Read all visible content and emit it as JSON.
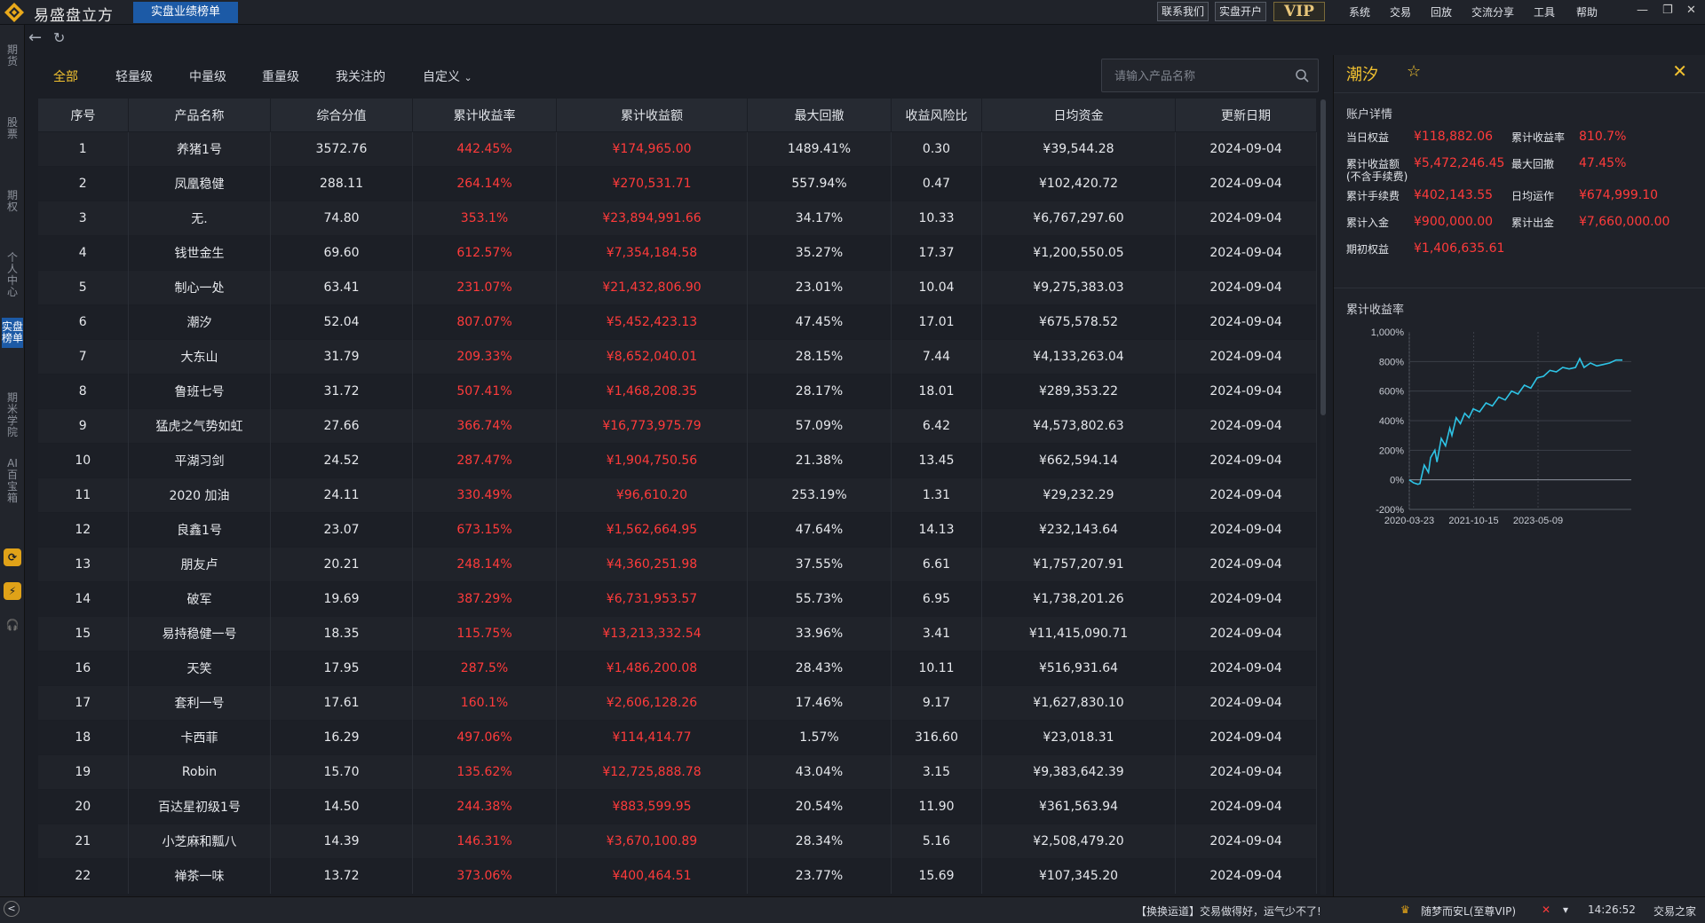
{
  "app": {
    "name": "易盛盘立方",
    "active_tab": "实盘业绩榜单"
  },
  "top_buttons": [
    "联系我们",
    "实盘开户"
  ],
  "vip_label": "VIP",
  "menu": [
    "系统",
    "交易",
    "回放",
    "交流分享",
    "工具",
    "帮助"
  ],
  "left_nav": [
    "期货",
    "股票",
    "期权",
    "个人中心",
    "实盘榜单",
    "期米学院",
    "AI百宝箱"
  ],
  "filters": [
    "全部",
    "轻量级",
    "中量级",
    "重量级",
    "我关注的",
    "自定义"
  ],
  "search": {
    "placeholder": "请输入产品名称"
  },
  "columns": [
    "序号",
    "产品名称",
    "综合分值",
    "累计收益率",
    "累计收益额",
    "最大回撤",
    "收益风险比",
    "日均资金",
    "更新日期"
  ],
  "rows": [
    [
      "1",
      "养猪1号",
      "3572.76",
      "442.45%",
      "¥174,965.00",
      "1489.41%",
      "0.30",
      "¥39,544.28",
      "2024-09-04"
    ],
    [
      "2",
      "凤凰稳健",
      "288.11",
      "264.14%",
      "¥270,531.71",
      "557.94%",
      "0.47",
      "¥102,420.72",
      "2024-09-04"
    ],
    [
      "3",
      "无.",
      "74.80",
      "353.1%",
      "¥23,894,991.66",
      "34.17%",
      "10.33",
      "¥6,767,297.60",
      "2024-09-04"
    ],
    [
      "4",
      "钱世金生",
      "69.60",
      "612.57%",
      "¥7,354,184.58",
      "35.27%",
      "17.37",
      "¥1,200,550.05",
      "2024-09-04"
    ],
    [
      "5",
      "制心一处",
      "63.41",
      "231.07%",
      "¥21,432,806.90",
      "23.01%",
      "10.04",
      "¥9,275,383.03",
      "2024-09-04"
    ],
    [
      "6",
      "潮汐",
      "52.04",
      "807.07%",
      "¥5,452,423.13",
      "47.45%",
      "17.01",
      "¥675,578.52",
      "2024-09-04"
    ],
    [
      "7",
      "大东山",
      "31.79",
      "209.33%",
      "¥8,652,040.01",
      "28.15%",
      "7.44",
      "¥4,133,263.04",
      "2024-09-04"
    ],
    [
      "8",
      "鲁班七号",
      "31.72",
      "507.41%",
      "¥1,468,208.35",
      "28.17%",
      "18.01",
      "¥289,353.22",
      "2024-09-04"
    ],
    [
      "9",
      "猛虎之气势如虹",
      "27.66",
      "366.74%",
      "¥16,773,975.79",
      "57.09%",
      "6.42",
      "¥4,573,802.63",
      "2024-09-04"
    ],
    [
      "10",
      "平湖习剑",
      "24.52",
      "287.47%",
      "¥1,904,750.56",
      "21.38%",
      "13.45",
      "¥662,594.14",
      "2024-09-04"
    ],
    [
      "11",
      "2020 加油",
      "24.11",
      "330.49%",
      "¥96,610.20",
      "253.19%",
      "1.31",
      "¥29,232.29",
      "2024-09-04"
    ],
    [
      "12",
      "良鑫1号",
      "23.07",
      "673.15%",
      "¥1,562,664.95",
      "47.64%",
      "14.13",
      "¥232,143.64",
      "2024-09-04"
    ],
    [
      "13",
      "朋友卢",
      "20.21",
      "248.14%",
      "¥4,360,251.98",
      "37.55%",
      "6.61",
      "¥1,757,207.91",
      "2024-09-04"
    ],
    [
      "14",
      "破军",
      "19.69",
      "387.29%",
      "¥6,731,953.57",
      "55.73%",
      "6.95",
      "¥1,738,201.26",
      "2024-09-04"
    ],
    [
      "15",
      "易持稳健一号",
      "18.35",
      "115.75%",
      "¥13,213,332.54",
      "33.96%",
      "3.41",
      "¥11,415,090.71",
      "2024-09-04"
    ],
    [
      "16",
      "天笑",
      "17.95",
      "287.5%",
      "¥1,486,200.08",
      "28.43%",
      "10.11",
      "¥516,931.64",
      "2024-09-04"
    ],
    [
      "17",
      "套利一号",
      "17.61",
      "160.1%",
      "¥2,606,128.26",
      "17.46%",
      "9.17",
      "¥1,627,830.10",
      "2024-09-04"
    ],
    [
      "18",
      "卡西菲",
      "16.29",
      "497.06%",
      "¥114,414.77",
      "1.57%",
      "316.60",
      "¥23,018.31",
      "2024-09-04"
    ],
    [
      "19",
      "Robin",
      "15.70",
      "135.62%",
      "¥12,725,888.78",
      "43.04%",
      "3.15",
      "¥9,383,642.39",
      "2024-09-04"
    ],
    [
      "20",
      "百达星初级1号",
      "14.50",
      "244.38%",
      "¥883,599.95",
      "20.54%",
      "11.90",
      "¥361,563.94",
      "2024-09-04"
    ],
    [
      "21",
      "小芝麻和瓢八",
      "14.39",
      "146.31%",
      "¥3,670,100.89",
      "28.34%",
      "5.16",
      "¥2,508,479.20",
      "2024-09-04"
    ],
    [
      "22",
      "禅茶一味",
      "13.72",
      "373.06%",
      "¥400,464.51",
      "23.77%",
      "15.69",
      "¥107,345.20",
      "2024-09-04"
    ]
  ],
  "detail": {
    "title": "潮汐",
    "section_account": "账户详情",
    "fields": [
      {
        "label": "当日权益",
        "value": "¥118,882.06"
      },
      {
        "label": "累计收益率",
        "value": "810.7%"
      },
      {
        "label": "累计收益额\n(不含手续费)",
        "value": "¥5,472,246.45"
      },
      {
        "label": "最大回撤",
        "value": "47.45%"
      },
      {
        "label": "累计手续费",
        "value": "¥402,143.55"
      },
      {
        "label": "日均运作",
        "value": "¥674,999.10"
      },
      {
        "label": "累计入金",
        "value": "¥900,000.00"
      },
      {
        "label": "累计出金",
        "value": "¥7,660,000.00"
      },
      {
        "label": "期初权益",
        "value": "¥1,406,635.61"
      }
    ],
    "section_chart": "累计收益率"
  },
  "chart_data": {
    "type": "line",
    "title": "累计收益率",
    "y_ticks": [
      "1,000%",
      "800%",
      "600%",
      "400%",
      "200%",
      "0%",
      "-200%"
    ],
    "x_ticks": [
      "2020-03-23",
      "2021-10-15",
      "2023-05-09"
    ],
    "ylim": [
      -200,
      1000
    ],
    "series": [
      {
        "color": "#2ec4e6",
        "points": [
          [
            0,
            0
          ],
          [
            0.02,
            -20
          ],
          [
            0.04,
            -30
          ],
          [
            0.05,
            -25
          ],
          [
            0.07,
            100
          ],
          [
            0.09,
            50
          ],
          [
            0.1,
            150
          ],
          [
            0.12,
            200
          ],
          [
            0.13,
            120
          ],
          [
            0.15,
            280
          ],
          [
            0.17,
            230
          ],
          [
            0.19,
            350
          ],
          [
            0.2,
            300
          ],
          [
            0.22,
            420
          ],
          [
            0.24,
            380
          ],
          [
            0.26,
            450
          ],
          [
            0.28,
            420
          ],
          [
            0.3,
            480
          ],
          [
            0.33,
            460
          ],
          [
            0.36,
            520
          ],
          [
            0.39,
            500
          ],
          [
            0.42,
            560
          ],
          [
            0.45,
            540
          ],
          [
            0.48,
            600
          ],
          [
            0.51,
            580
          ],
          [
            0.54,
            640
          ],
          [
            0.57,
            620
          ],
          [
            0.6,
            690
          ],
          [
            0.63,
            700
          ],
          [
            0.66,
            740
          ],
          [
            0.69,
            730
          ],
          [
            0.72,
            760
          ],
          [
            0.75,
            750
          ],
          [
            0.78,
            760
          ],
          [
            0.8,
            820
          ],
          [
            0.82,
            760
          ],
          [
            0.85,
            790
          ],
          [
            0.88,
            770
          ],
          [
            0.91,
            780
          ],
          [
            0.94,
            790
          ],
          [
            0.97,
            810
          ],
          [
            1,
            810
          ]
        ]
      }
    ]
  },
  "status": {
    "message": "【换换运道】交易做得好，运气少不了!",
    "user": "随梦而安L(至尊VIP)",
    "time": "14:26:52",
    "site": "交易之家"
  }
}
